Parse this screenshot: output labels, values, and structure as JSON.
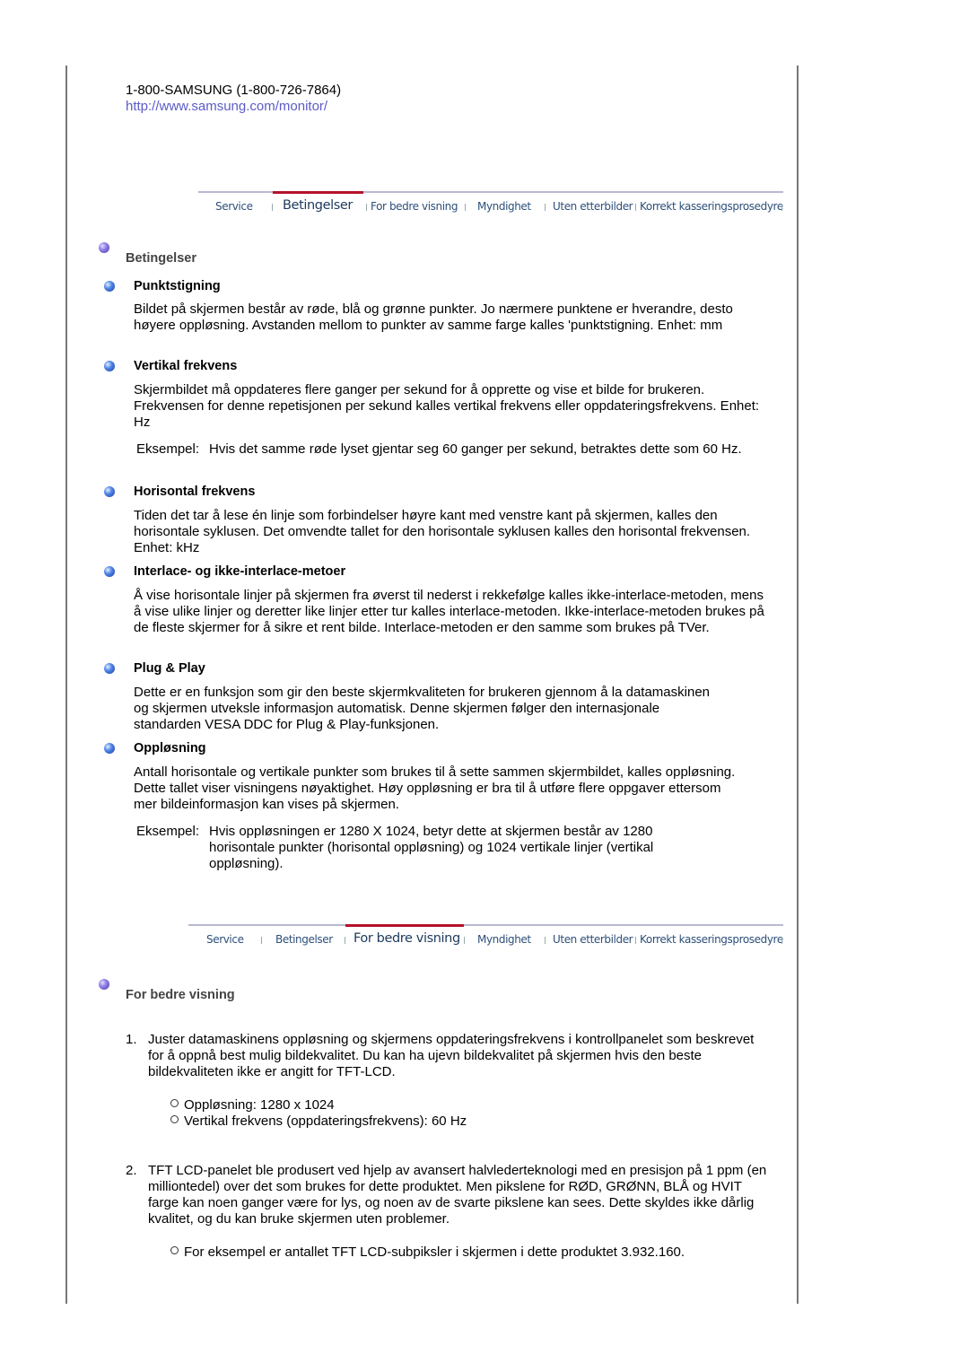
{
  "contact": {
    "phone": "1-800-SAMSUNG (1-800-726-7864)",
    "url": "http://www.samsung.com/monitor/"
  },
  "nav_tabs": [
    "Service",
    "Betingelser",
    "For bedre visning",
    "Myndighet",
    "Uten etterbilder",
    "Korrekt kasseringsprosedyre"
  ],
  "nav1_active": "Betingelser",
  "nav2_active": "For bedre visning",
  "section1": {
    "title": "Betingelser",
    "terms": [
      {
        "title": "Punktstigning",
        "text": "Bildet på skjermen består av røde, blå og grønne punkter. Jo nærmere punktene er hverandre, desto høyere oppløsning. Avstanden mellom to punkter av samme farge kalles 'punktstigning. Enhet: mm"
      },
      {
        "title": "Vertikal frekvens",
        "text": "Skjermbildet må oppdateres flere ganger per sekund for å opprette og vise et bilde for brukeren. Frekvensen for denne repetisjonen per sekund kalles vertikal frekvens eller oppdateringsfrekvens. Enhet: Hz",
        "example_label": "Eksempel:",
        "example_text": "Hvis det samme røde lyset gjentar seg 60 ganger per sekund, betraktes dette som 60 Hz."
      },
      {
        "title": "Horisontal frekvens",
        "text": "Tiden det tar å lese én linje som forbindelser høyre kant med venstre kant på skjermen, kalles den horisontale syklusen. Det omvendte tallet for den horisontale syklusen kalles den horisontal frekvensen. Enhet: kHz"
      },
      {
        "title": "Interlace- og ikke-interlace-metoer",
        "text": "Å vise horisontale linjer på skjermen fra øverst til nederst i rekkefølge kalles ikke-interlace-metoden, mens å vise ulike linjer og deretter like linjer etter tur kalles interlace-metoden. Ikke-interlace-metoden brukes på de fleste skjermer for å sikre et rent bilde. Interlace-metoden er den samme som brukes på TVer."
      },
      {
        "title": "Plug & Play",
        "text": "Dette er en funksjon som gir den beste skjermkvaliteten for brukeren gjennom å la datamaskinen og skjermen utveksle informasjon automatisk. Denne skjermen følger den internasjonale standarden VESA DDC for Plug & Play-funksjonen."
      },
      {
        "title": "Oppløsning",
        "text": "Antall horisontale og vertikale punkter som brukes til å sette sammen skjermbildet, kalles oppløsning. Dette tallet viser visningens nøyaktighet. Høy oppløsning er bra til å utføre flere oppgaver ettersom mer bildeinformasjon kan vises på skjermen.",
        "example_label": "Eksempel:",
        "example_text": "Hvis oppløsningen er 1280 X 1024, betyr dette at skjermen består av 1280 horisontale punkter (horisontal oppløsning) og 1024 vertikale linjer (vertikal oppløsning)."
      }
    ]
  },
  "section2": {
    "title": "For bedre visning",
    "items": [
      {
        "num": "1.",
        "text": "Juster datamaskinens oppløsning og skjermens oppdateringsfrekvens i kontrollpanelet som beskrevet for å oppnå best mulig bildekvalitet. Du kan ha ujevn bildekvalitet på skjermen hvis den beste bildekvaliteten ikke er angitt for TFT-LCD.",
        "subitems": [
          "Oppløsning: 1280 x 1024",
          "Vertikal frekvens (oppdateringsfrekvens): 60 Hz"
        ]
      },
      {
        "num": "2.",
        "text": "TFT LCD-panelet ble produsert ved hjelp av avansert halvlederteknologi med en presisjon på 1 ppm (en milliontedel) over det som brukes for dette produktet. Men pikslene for RØD, GRØNN, BLÅ og HVIT farge kan noen ganger være for lys, og noen av de svarte pikslene kan sees. Dette skyldes ikke dårlig kvalitet, og du kan bruke skjermen uten problemer.",
        "subitems": [
          "For eksempel er antallet TFT LCD-subpiksler i skjermen i dette produktet 3.932.160."
        ]
      }
    ]
  },
  "colors": {
    "link": "#5b5bc8",
    "nav_text": "#2d4f7a",
    "nav_active_bar": "#b5122a",
    "section_title": "#444444"
  }
}
